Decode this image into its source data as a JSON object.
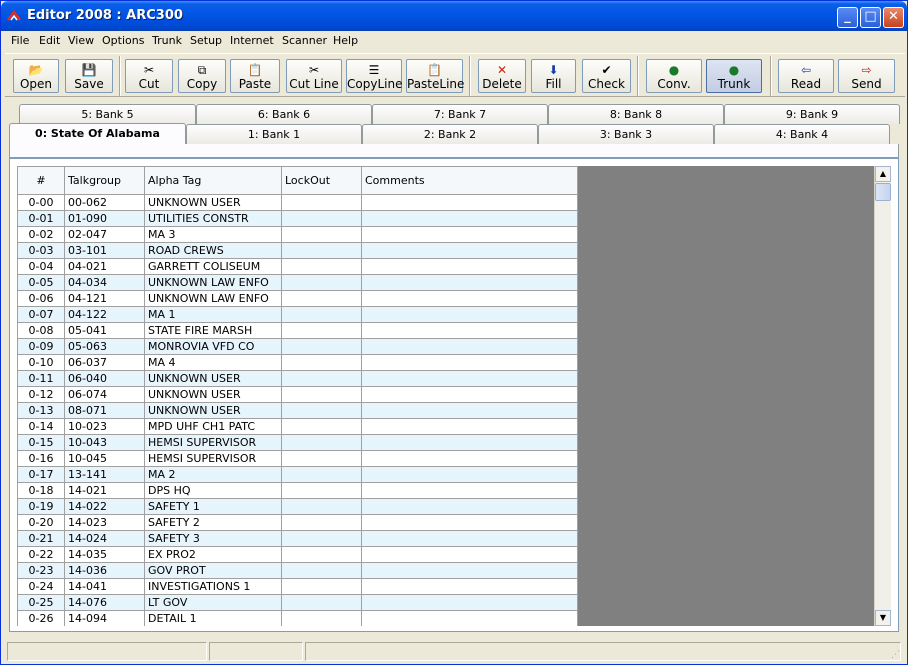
{
  "window": {
    "title": "Editor 2008 : ARC300"
  },
  "menu": [
    "File",
    "Edit",
    "View",
    "Options",
    "Trunk",
    "Setup",
    "Internet",
    "Scanner",
    "Help"
  ],
  "toolbar": {
    "open": "Open",
    "save": "Save",
    "cut": "Cut",
    "copy": "Copy",
    "paste": "Paste",
    "cut_line": "Cut Line",
    "copy_line": "CopyLine",
    "paste_line": "PasteLine",
    "delete": "Delete",
    "fill": "Fill",
    "check": "Check",
    "conv": "Conv.",
    "trunk": "Trunk",
    "read": "Read",
    "send": "Send"
  },
  "tabs_back": [
    "5: Bank 5",
    "6: Bank 6",
    "7: Bank 7",
    "8: Bank 8",
    "9: Bank 9"
  ],
  "tabs_front": [
    "0: State Of Alabama",
    "1: Bank 1",
    "2: Bank 2",
    "3: Bank 3",
    "4: Bank 4"
  ],
  "grid": {
    "columns": [
      "#",
      "Talkgroup",
      "Alpha Tag",
      "LockOut",
      "Comments"
    ],
    "rows": [
      [
        "0-00",
        "00-062",
        "UNKNOWN USER"
      ],
      [
        "0-01",
        "01-090",
        "UTILITIES CONSTR"
      ],
      [
        "0-02",
        "02-047",
        "MA 3"
      ],
      [
        "0-03",
        "03-101",
        "ROAD CREWS"
      ],
      [
        "0-04",
        "04-021",
        "GARRETT COLISEUM"
      ],
      [
        "0-05",
        "04-034",
        "UNKNOWN LAW ENFO"
      ],
      [
        "0-06",
        "04-121",
        "UNKNOWN LAW ENFO"
      ],
      [
        "0-07",
        "04-122",
        "MA 1"
      ],
      [
        "0-08",
        "05-041",
        "STATE FIRE MARSH"
      ],
      [
        "0-09",
        "05-063",
        "MONROVIA VFD  CO"
      ],
      [
        "0-10",
        "06-037",
        "MA 4"
      ],
      [
        "0-11",
        "06-040",
        "UNKNOWN USER"
      ],
      [
        "0-12",
        "06-074",
        "UNKNOWN USER"
      ],
      [
        "0-13",
        "08-071",
        "UNKNOWN USER"
      ],
      [
        "0-14",
        "10-023",
        "MPD UHF CH1 PATC"
      ],
      [
        "0-15",
        "10-043",
        "HEMSI SUPERVISOR"
      ],
      [
        "0-16",
        "10-045",
        "HEMSI SUPERVISOR"
      ],
      [
        "0-17",
        "13-141",
        "MA 2"
      ],
      [
        "0-18",
        "14-021",
        "DPS HQ"
      ],
      [
        "0-19",
        "14-022",
        "SAFETY 1"
      ],
      [
        "0-20",
        "14-023",
        "SAFETY 2"
      ],
      [
        "0-21",
        "14-024",
        "SAFETY 3"
      ],
      [
        "0-22",
        "14-035",
        "EX PRO2"
      ],
      [
        "0-23",
        "14-036",
        "GOV PROT"
      ],
      [
        "0-24",
        "14-041",
        "INVESTIGATIONS 1"
      ],
      [
        "0-25",
        "14-076",
        "LT GOV"
      ],
      [
        "0-26",
        "14-094",
        "DETAIL 1"
      ]
    ]
  },
  "colors": {
    "row_alt": "#e6f4fc",
    "title_bar": "#0054e3",
    "empty_area": "#808080"
  },
  "statusbar": [
    "",
    "",
    ""
  ]
}
